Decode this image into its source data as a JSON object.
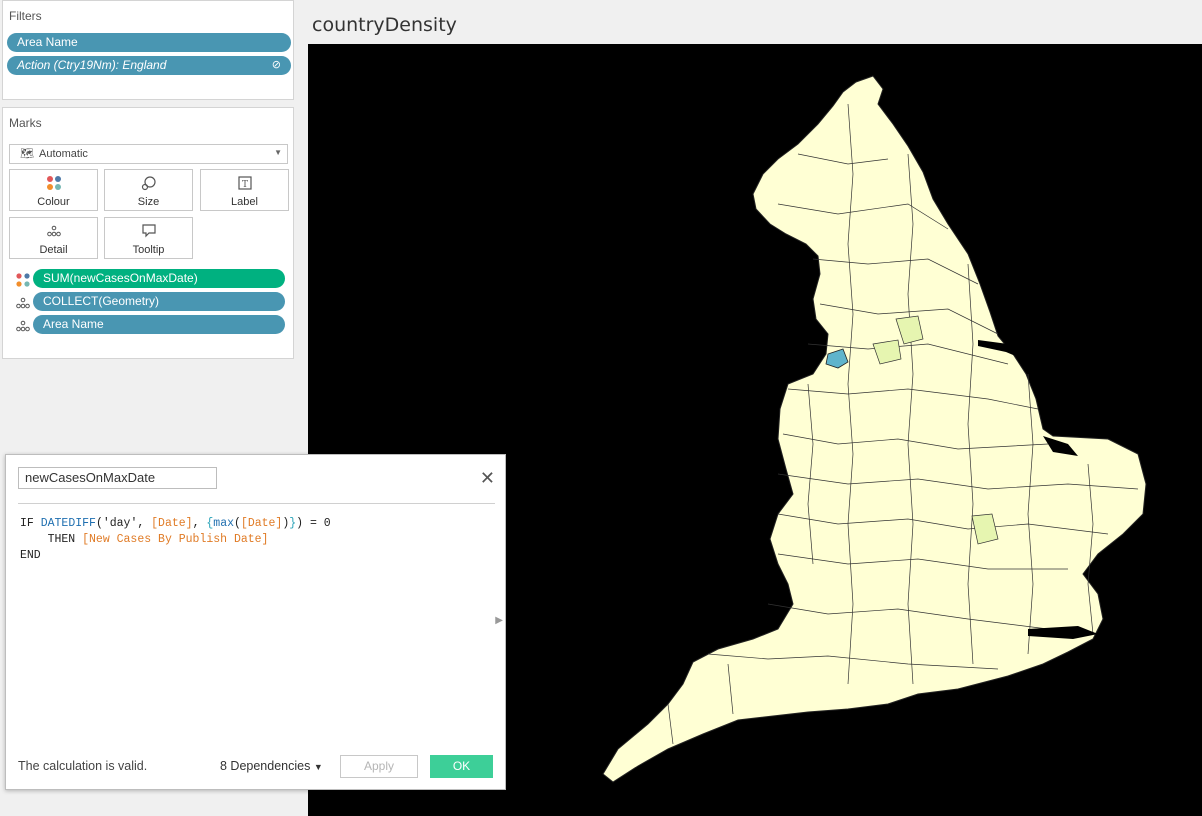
{
  "filters": {
    "title": "Filters",
    "items": [
      {
        "label": "Area Name"
      },
      {
        "label": "Action (Ctry19Nm): England"
      }
    ]
  },
  "marks": {
    "title": "Marks",
    "mark_type": "Automatic",
    "buttons": [
      {
        "label": "Colour",
        "icon": "colour-icon"
      },
      {
        "label": "Size",
        "icon": "size-icon"
      },
      {
        "label": "Label",
        "icon": "label-icon"
      },
      {
        "label": "Detail",
        "icon": "detail-icon"
      },
      {
        "label": "Tooltip",
        "icon": "tooltip-icon"
      }
    ],
    "shelf": [
      {
        "label": "SUM(newCasesOnMaxDate)",
        "icon": "colour-icon",
        "color": "#00b180"
      },
      {
        "label": "COLLECT(Geometry)",
        "icon": "detail-icon",
        "color": "#4996b2"
      },
      {
        "label": "Area Name",
        "icon": "detail-icon",
        "color": "#4996b2"
      }
    ]
  },
  "map": {
    "title": "countryDensity",
    "background": "#000000",
    "fill_color": "#ffffd4"
  },
  "calc_dialog": {
    "name": "newCasesOnMaxDate",
    "code": {
      "if": "IF ",
      "datediff": "DATEDIFF",
      "arg1": "('day', ",
      "date_field": "[Date]",
      "comma": ", ",
      "lod_open": "{",
      "max_fn": "max",
      "paren_open": "(",
      "date_field2": "[Date]",
      "paren_close": ")",
      "lod_close": "}",
      "tail": ") = 0",
      "then": "    THEN ",
      "then_field": "[New Cases By Publish Date]",
      "end": "END"
    },
    "status": "The calculation is valid.",
    "dependencies": "8 Dependencies",
    "apply_label": "Apply",
    "ok_label": "OK"
  }
}
